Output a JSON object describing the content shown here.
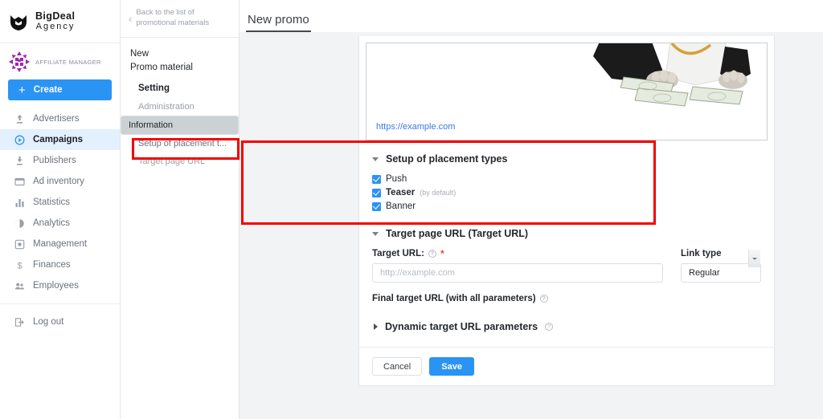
{
  "brand": {
    "name": "BigDeal",
    "sub": "Agency",
    "logo_icon": "bigdeal-logo-icon"
  },
  "profile": {
    "role": "AFFILIATE MANAGER",
    "avatar_icon": "affiliate-manager-avatar"
  },
  "create": {
    "label": "Create",
    "plus": "+"
  },
  "nav": {
    "items": [
      {
        "label": "Advertisers",
        "icon": "upload-arrow-icon",
        "active": false
      },
      {
        "label": "Campaigns",
        "icon": "play-circle-icon",
        "active": true
      },
      {
        "label": "Publishers",
        "icon": "download-arrow-icon",
        "active": false
      },
      {
        "label": "Ad inventory",
        "icon": "window-icon",
        "active": false
      },
      {
        "label": "Statistics",
        "icon": "bar-chart-icon",
        "active": false
      },
      {
        "label": "Analytics",
        "icon": "pie-chart-icon",
        "active": false
      },
      {
        "label": "Management",
        "icon": "gear-box-icon",
        "active": false
      },
      {
        "label": "Finances",
        "icon": "dollar-icon",
        "active": false
      },
      {
        "label": "Employees",
        "icon": "people-icon",
        "active": false
      }
    ],
    "logout": {
      "label": "Log out",
      "icon": "logout-icon"
    }
  },
  "subnav": {
    "back": {
      "line1": "Back to the list of",
      "line2": "promotional materials",
      "chevron": "‹"
    },
    "title_line1": "New",
    "title_line2": "Promo material",
    "heading": "Setting",
    "items": [
      {
        "label": "Administration",
        "state": "default"
      },
      {
        "label": "Information",
        "state": "selected"
      },
      {
        "label": "Setup of placement t...",
        "state": "current"
      },
      {
        "label": "Target page URL",
        "state": "default"
      }
    ]
  },
  "tabbar": {
    "active_tab": "New promo"
  },
  "preview": {
    "link": "https://example.com",
    "image_alt": "paws-with-dollar-bills-photo"
  },
  "placement": {
    "title": "Setup of placement types",
    "options": [
      {
        "label": "Push",
        "note": "",
        "checked": true,
        "bold": false
      },
      {
        "label": "Teaser",
        "note": "(by default)",
        "checked": true,
        "bold": true
      },
      {
        "label": "Banner",
        "note": "",
        "checked": true,
        "bold": false
      }
    ]
  },
  "target": {
    "title": "Target page URL (Target URL)",
    "url_label": "Target URL:",
    "url_value": "",
    "url_placeholder": "http://example.com",
    "required_mark": "*",
    "help_glyph": "?",
    "link_type_label": "Link type",
    "link_type_value": "Regular",
    "link_type_options": [
      "Regular"
    ],
    "final_url_label": "Final target URL (with all parameters)",
    "dynamic_label": "Dynamic target URL parameters"
  },
  "footer": {
    "cancel": "Cancel",
    "save": "Save"
  },
  "colors": {
    "accent": "#2a94f4",
    "highlight": "#f50000",
    "link": "#3b78e7"
  }
}
